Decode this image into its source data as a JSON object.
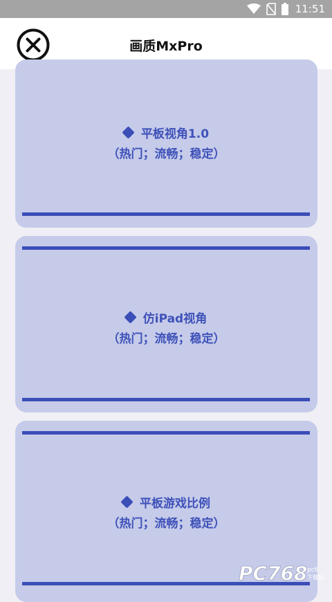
{
  "status_bar": {
    "time": "11:51",
    "icons": [
      "wifi-icon",
      "no-sim-icon",
      "battery-icon"
    ]
  },
  "header": {
    "title": "画质MxPro",
    "close_icon": "close-icon"
  },
  "options": [
    {
      "title": "平板视角1.0",
      "subtitle": "（热门；流畅；稳定）"
    },
    {
      "title": "仿iPad视角",
      "subtitle": "（热门；流畅；稳定）"
    },
    {
      "title": "平板游戏比例",
      "subtitle": "（热门；流畅；稳定）"
    }
  ],
  "watermark": {
    "text": "PC768",
    "subtext": "pc6下载站"
  },
  "colors": {
    "status_bar": "#a4a4a4",
    "card_bg": "#c5cbe9",
    "accent": "#3b4db7",
    "page_bg": "#f0eff5"
  }
}
